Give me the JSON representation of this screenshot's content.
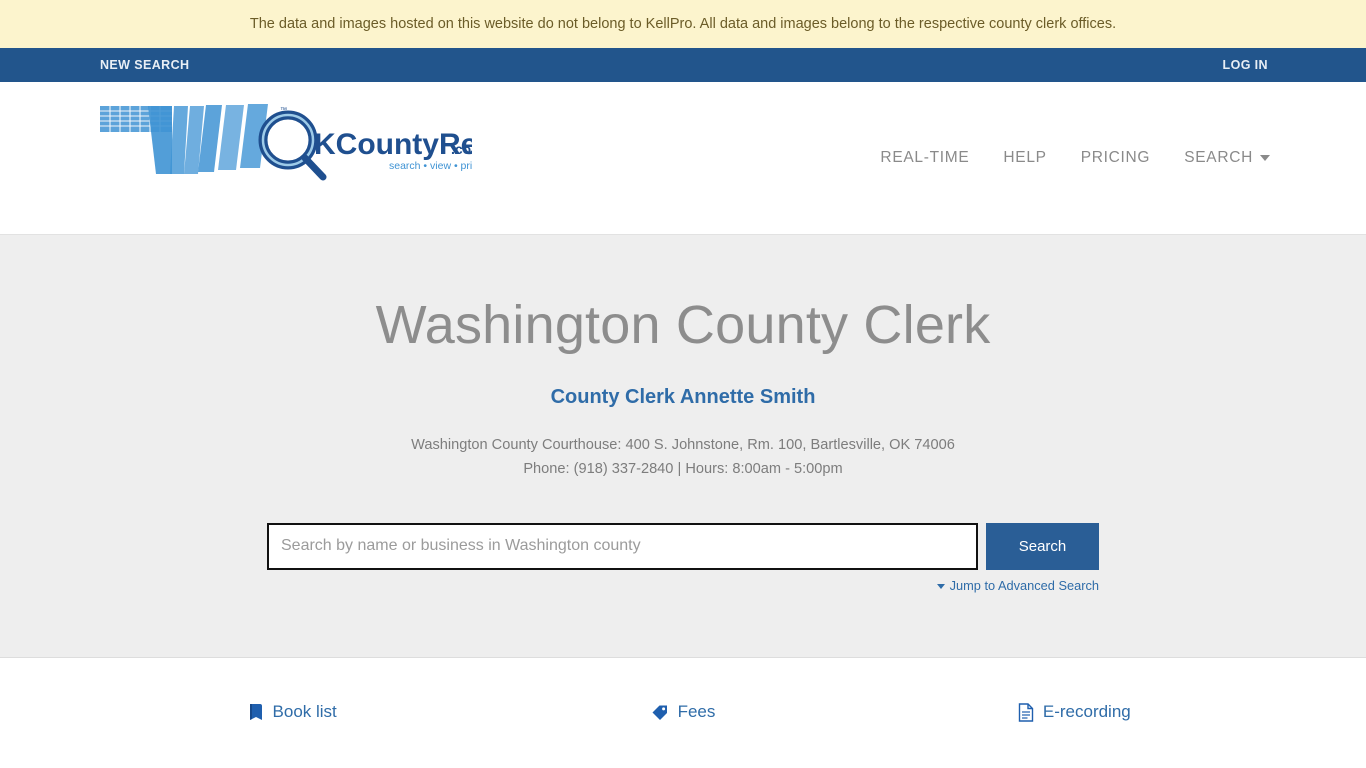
{
  "banner": {
    "text": "The data and images hosted on this website do not belong to KellPro. All data and images belong to the respective county clerk offices.",
    "bg_color": "#fcf4cd",
    "text_color": "#6b5c28"
  },
  "utilbar": {
    "bg_color": "#22558c",
    "new_search_label": "NEW SEARCH",
    "login_label": "LOG IN"
  },
  "logo": {
    "name_ok": "OK",
    "name_rest": "CountyRecords",
    "domain": ".com",
    "tagline": "search • view • print",
    "trademark": "™",
    "brand_color": "#2f76bd"
  },
  "mainnav": {
    "items": [
      {
        "label": "REAL-TIME"
      },
      {
        "label": "HELP"
      },
      {
        "label": "PRICING"
      },
      {
        "label": "SEARCH",
        "has_caret": true
      }
    ]
  },
  "hero": {
    "title": "Washington County Clerk",
    "clerk_link": "County Clerk Annette Smith",
    "address_line": "Washington County Courthouse: 400 S. Johnstone, Rm. 100, Bartlesville, OK 74006",
    "contact_line": "Phone: (918) 337-2840 | Hours: 8:00am - 5:00pm",
    "bg_color": "#eeeeee",
    "accent_color": "#2f6ca8"
  },
  "search": {
    "placeholder": "Search by name or business in Washington county",
    "value": "",
    "button_label": "Search",
    "advanced_label": "Jump to Advanced Search",
    "button_color": "#2a5e96"
  },
  "quicklinks": [
    {
      "label": "Book list",
      "icon": "book-icon"
    },
    {
      "label": "Fees",
      "icon": "tag-icon"
    },
    {
      "label": "E-recording",
      "icon": "document-icon"
    }
  ]
}
